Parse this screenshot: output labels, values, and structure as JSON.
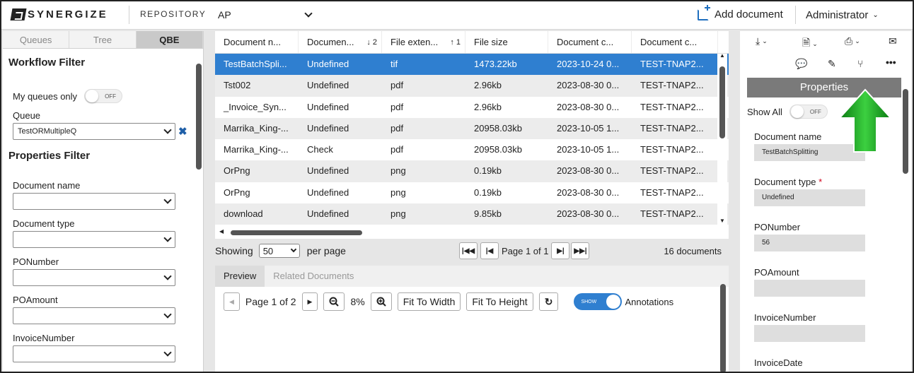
{
  "header": {
    "logo_text": "SYNERGIZE",
    "repository_label": "REPOSITORY",
    "repository_value": "AP",
    "add_document": "Add document",
    "user": "Administrator"
  },
  "left_panel": {
    "tabs": [
      "Queues",
      "Tree",
      "QBE"
    ],
    "active_tab": "QBE",
    "workflow_filter_title": "Workflow Filter",
    "my_queues_label": "My queues only",
    "my_queues_toggle": "OFF",
    "queue_label": "Queue",
    "queue_value": "TestORMultipleQ",
    "properties_filter_title": "Properties Filter",
    "fields": [
      {
        "label": "Document name",
        "value": ""
      },
      {
        "label": "Document type",
        "value": ""
      },
      {
        "label": "PONumber",
        "value": ""
      },
      {
        "label": "POAmount",
        "value": ""
      },
      {
        "label": "InvoiceNumber",
        "value": ""
      }
    ]
  },
  "grid": {
    "columns": [
      {
        "label": "Document n...",
        "sort": ""
      },
      {
        "label": "Documen...",
        "sort": "↓ 2"
      },
      {
        "label": "File exten...",
        "sort": "↑ 1"
      },
      {
        "label": "File size",
        "sort": ""
      },
      {
        "label": "Document c...",
        "sort": ""
      },
      {
        "label": "Document c...",
        "sort": ""
      }
    ],
    "rows": [
      [
        "TestBatchSpli...",
        "Undefined",
        "tif",
        "1473.22kb",
        "2023-10-24 0...",
        "TEST-TNAP2..."
      ],
      [
        "Tst002",
        "Undefined",
        "pdf",
        "2.96kb",
        "2023-08-30 0...",
        "TEST-TNAP2..."
      ],
      [
        "_Invoice_Syn...",
        "Undefined",
        "pdf",
        "2.96kb",
        "2023-08-30 0...",
        "TEST-TNAP2..."
      ],
      [
        "Marrika_King-...",
        "Undefined",
        "pdf",
        "20958.03kb",
        "2023-10-05 1...",
        "TEST-TNAP2..."
      ],
      [
        "Marrika_King-...",
        "Check",
        "pdf",
        "20958.03kb",
        "2023-10-05 1...",
        "TEST-TNAP2..."
      ],
      [
        "OrPng",
        "Undefined",
        "png",
        "0.19kb",
        "2023-08-30 0...",
        "TEST-TNAP2..."
      ],
      [
        "OrPng",
        "Undefined",
        "png",
        "0.19kb",
        "2023-08-30 0...",
        "TEST-TNAP2..."
      ],
      [
        "download",
        "Undefined",
        "png",
        "9.85kb",
        "2023-08-30 0...",
        "TEST-TNAP2..."
      ]
    ],
    "selected_row": 0
  },
  "pager": {
    "showing_label": "Showing",
    "per_page_value": "50",
    "per_page_label": "per page",
    "page_text": "Page 1 of 1",
    "total": "16 documents"
  },
  "preview": {
    "tabs": [
      "Preview",
      "Related Documents"
    ],
    "page_text": "Page 1 of 2",
    "zoom": "8%",
    "fit_width": "Fit To Width",
    "fit_height": "Fit To Height",
    "show_toggle": "SHOW",
    "annotations_label": "Annotations"
  },
  "right_panel": {
    "title": "Properties",
    "show_all_label": "Show All",
    "show_all_toggle": "OFF",
    "fields": [
      {
        "label": "Document name",
        "value": "TestBatchSplitting",
        "required": false
      },
      {
        "label": "Document type",
        "value": "Undefined",
        "required": true
      },
      {
        "label": "PONumber",
        "value": "56",
        "required": false
      },
      {
        "label": "POAmount",
        "value": "",
        "required": false
      },
      {
        "label": "InvoiceNumber",
        "value": "",
        "required": false
      },
      {
        "label": "InvoiceDate",
        "value": "",
        "required": false
      }
    ],
    "required_mark": "*"
  },
  "colors": {
    "accent": "#2f7fd0",
    "arrow": "#1aa020",
    "required": "#d0021b"
  }
}
